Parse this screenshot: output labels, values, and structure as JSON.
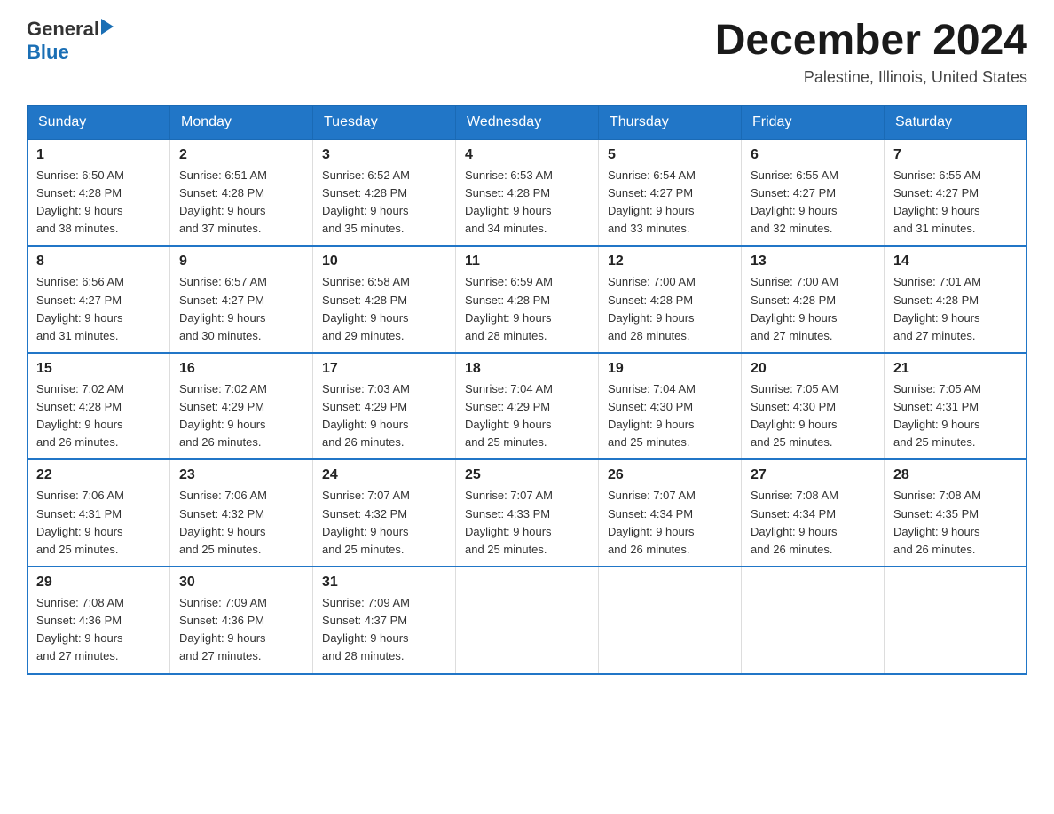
{
  "header": {
    "logo": {
      "text_general": "General",
      "text_blue": "Blue",
      "arrow_symbol": "▶"
    },
    "title": "December 2024",
    "location": "Palestine, Illinois, United States"
  },
  "weekdays": [
    "Sunday",
    "Monday",
    "Tuesday",
    "Wednesday",
    "Thursday",
    "Friday",
    "Saturday"
  ],
  "weeks": [
    [
      {
        "day": "1",
        "sunrise": "6:50 AM",
        "sunset": "4:28 PM",
        "daylight": "9 hours and 38 minutes."
      },
      {
        "day": "2",
        "sunrise": "6:51 AM",
        "sunset": "4:28 PM",
        "daylight": "9 hours and 37 minutes."
      },
      {
        "day": "3",
        "sunrise": "6:52 AM",
        "sunset": "4:28 PM",
        "daylight": "9 hours and 35 minutes."
      },
      {
        "day": "4",
        "sunrise": "6:53 AM",
        "sunset": "4:28 PM",
        "daylight": "9 hours and 34 minutes."
      },
      {
        "day": "5",
        "sunrise": "6:54 AM",
        "sunset": "4:27 PM",
        "daylight": "9 hours and 33 minutes."
      },
      {
        "day": "6",
        "sunrise": "6:55 AM",
        "sunset": "4:27 PM",
        "daylight": "9 hours and 32 minutes."
      },
      {
        "day": "7",
        "sunrise": "6:55 AM",
        "sunset": "4:27 PM",
        "daylight": "9 hours and 31 minutes."
      }
    ],
    [
      {
        "day": "8",
        "sunrise": "6:56 AM",
        "sunset": "4:27 PM",
        "daylight": "9 hours and 31 minutes."
      },
      {
        "day": "9",
        "sunrise": "6:57 AM",
        "sunset": "4:27 PM",
        "daylight": "9 hours and 30 minutes."
      },
      {
        "day": "10",
        "sunrise": "6:58 AM",
        "sunset": "4:28 PM",
        "daylight": "9 hours and 29 minutes."
      },
      {
        "day": "11",
        "sunrise": "6:59 AM",
        "sunset": "4:28 PM",
        "daylight": "9 hours and 28 minutes."
      },
      {
        "day": "12",
        "sunrise": "7:00 AM",
        "sunset": "4:28 PM",
        "daylight": "9 hours and 28 minutes."
      },
      {
        "day": "13",
        "sunrise": "7:00 AM",
        "sunset": "4:28 PM",
        "daylight": "9 hours and 27 minutes."
      },
      {
        "day": "14",
        "sunrise": "7:01 AM",
        "sunset": "4:28 PM",
        "daylight": "9 hours and 27 minutes."
      }
    ],
    [
      {
        "day": "15",
        "sunrise": "7:02 AM",
        "sunset": "4:28 PM",
        "daylight": "9 hours and 26 minutes."
      },
      {
        "day": "16",
        "sunrise": "7:02 AM",
        "sunset": "4:29 PM",
        "daylight": "9 hours and 26 minutes."
      },
      {
        "day": "17",
        "sunrise": "7:03 AM",
        "sunset": "4:29 PM",
        "daylight": "9 hours and 26 minutes."
      },
      {
        "day": "18",
        "sunrise": "7:04 AM",
        "sunset": "4:29 PM",
        "daylight": "9 hours and 25 minutes."
      },
      {
        "day": "19",
        "sunrise": "7:04 AM",
        "sunset": "4:30 PM",
        "daylight": "9 hours and 25 minutes."
      },
      {
        "day": "20",
        "sunrise": "7:05 AM",
        "sunset": "4:30 PM",
        "daylight": "9 hours and 25 minutes."
      },
      {
        "day": "21",
        "sunrise": "7:05 AM",
        "sunset": "4:31 PM",
        "daylight": "9 hours and 25 minutes."
      }
    ],
    [
      {
        "day": "22",
        "sunrise": "7:06 AM",
        "sunset": "4:31 PM",
        "daylight": "9 hours and 25 minutes."
      },
      {
        "day": "23",
        "sunrise": "7:06 AM",
        "sunset": "4:32 PM",
        "daylight": "9 hours and 25 minutes."
      },
      {
        "day": "24",
        "sunrise": "7:07 AM",
        "sunset": "4:32 PM",
        "daylight": "9 hours and 25 minutes."
      },
      {
        "day": "25",
        "sunrise": "7:07 AM",
        "sunset": "4:33 PM",
        "daylight": "9 hours and 25 minutes."
      },
      {
        "day": "26",
        "sunrise": "7:07 AM",
        "sunset": "4:34 PM",
        "daylight": "9 hours and 26 minutes."
      },
      {
        "day": "27",
        "sunrise": "7:08 AM",
        "sunset": "4:34 PM",
        "daylight": "9 hours and 26 minutes."
      },
      {
        "day": "28",
        "sunrise": "7:08 AM",
        "sunset": "4:35 PM",
        "daylight": "9 hours and 26 minutes."
      }
    ],
    [
      {
        "day": "29",
        "sunrise": "7:08 AM",
        "sunset": "4:36 PM",
        "daylight": "9 hours and 27 minutes."
      },
      {
        "day": "30",
        "sunrise": "7:09 AM",
        "sunset": "4:36 PM",
        "daylight": "9 hours and 27 minutes."
      },
      {
        "day": "31",
        "sunrise": "7:09 AM",
        "sunset": "4:37 PM",
        "daylight": "9 hours and 28 minutes."
      },
      null,
      null,
      null,
      null
    ]
  ],
  "labels": {
    "sunrise_prefix": "Sunrise: ",
    "sunset_prefix": "Sunset: ",
    "daylight_prefix": "Daylight: "
  }
}
